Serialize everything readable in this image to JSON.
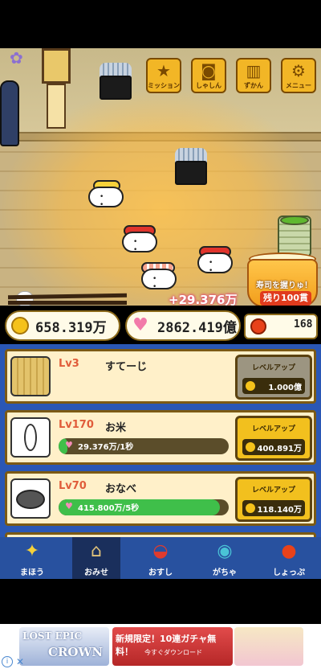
{
  "top_menu": [
    {
      "label": "ミッション",
      "icon": "medal-icon",
      "glyph": "★"
    },
    {
      "label": "しゃしん",
      "icon": "camera-icon",
      "glyph": "◙"
    },
    {
      "label": "ずかん",
      "icon": "book-icon",
      "glyph": "▥"
    },
    {
      "label": "メニュー",
      "icon": "gear-icon",
      "glyph": "⚙"
    }
  ],
  "scene": {
    "floating_income": "+29.376万",
    "rice_tub_title": "寿司を握りゅ！",
    "rice_tub_remaining": "残り100貫"
  },
  "currency": {
    "coins": "658.319万",
    "hearts": "2862.419億",
    "gems": "168"
  },
  "shop": {
    "items": [
      {
        "level": "Lv3",
        "name": "すてーじ",
        "rate": "",
        "button_label": "レベルアップ",
        "cost": "1.000億",
        "affordable": false
      },
      {
        "level": "Lv170",
        "name": "お米",
        "rate": "29.376万/1秒",
        "rate_fill": 0.05,
        "button_label": "レベルアップ",
        "cost": "400.891万",
        "affordable": true
      },
      {
        "level": "Lv70",
        "name": "おなべ",
        "rate": "415.800万/5秒",
        "rate_fill": 0.95,
        "button_label": "レベルアップ",
        "cost": "118.140万",
        "affordable": true
      }
    ]
  },
  "nav": {
    "items": [
      {
        "label": "まほう",
        "icon": "magic-sparkle-icon",
        "glyph": "✦",
        "active": false
      },
      {
        "label": "おみせ",
        "icon": "shop-icon",
        "glyph": "⌂",
        "active": true
      },
      {
        "label": "おすし",
        "icon": "sushi-icon",
        "glyph": "◒",
        "active": false
      },
      {
        "label": "がちゃ",
        "icon": "gacha-icon",
        "glyph": "◉",
        "active": false
      },
      {
        "label": "しょっぷ",
        "icon": "ruby-icon",
        "glyph": "●",
        "active": false
      }
    ]
  },
  "ad": {
    "logo_line1": "LOST EPIC",
    "logo_line2": "CROWN",
    "promo_line1": "新規限定！10連ガチャ無料！",
    "promo_line2": "今すぐダウンロード",
    "info_symbol": "i",
    "close_symbol": "✕"
  },
  "colors": {
    "panel_blue": "#2a57b5",
    "card_bg": "#fff0c9",
    "button_active": "#f2c01e",
    "button_inactive": "#9c9581",
    "heart_pink": "#f27aa9",
    "coin_gold": "#f5c21b",
    "gem_red": "#e8421a"
  }
}
